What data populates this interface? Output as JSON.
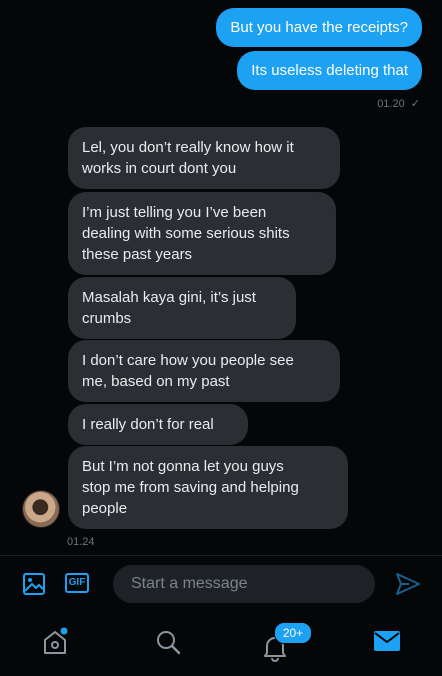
{
  "conversation": {
    "sent": [
      {
        "text": "But you have the receipts?"
      },
      {
        "text": "Its useless deleting that"
      }
    ],
    "sent_time": "01.20",
    "received": [
      {
        "text": "Lel, you don’t really know how it\nworks in court dont you"
      },
      {
        "text": "I’m just telling you I’ve been\ndealing with some serious shits\nthese past years"
      },
      {
        "text": "Masalah kaya gini, it’s just\ncrumbs"
      },
      {
        "text": "I don’t care how you people see\nme, based on my past"
      },
      {
        "text": "I really don’t for real"
      },
      {
        "text": "But I’m not gonna let you guys\nstop me from saving and helping\npeople"
      }
    ],
    "received_time": "01.24"
  },
  "composer": {
    "image_icon": "image-icon",
    "gif_label": "GIF",
    "placeholder": "Start a message",
    "send_icon": "send-icon"
  },
  "tabbar": {
    "home_icon": "home-icon",
    "search_icon": "search-icon",
    "notifications_icon": "bell-icon",
    "notifications_badge": "20+",
    "messages_icon": "mail-icon"
  },
  "colors": {
    "accent": "#1da1f2",
    "received_bubble": "#2b2f33",
    "background": "#050608"
  }
}
